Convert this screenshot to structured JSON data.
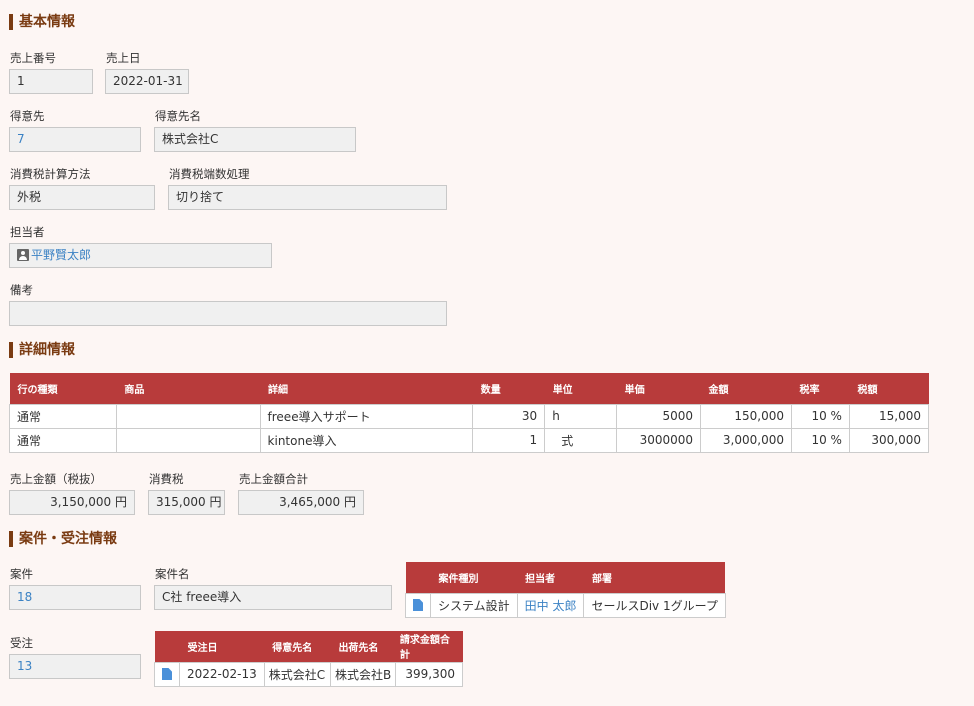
{
  "basic": {
    "title": "基本情報",
    "sales_no": {
      "label": "売上番号",
      "value": "1"
    },
    "sales_date": {
      "label": "売上日",
      "value": "2022-01-31"
    },
    "customer": {
      "label": "得意先",
      "value": "7"
    },
    "customer_name": {
      "label": "得意先名",
      "value": "株式会社C"
    },
    "tax_method": {
      "label": "消費税計算方法",
      "value": "外税"
    },
    "tax_rounding": {
      "label": "消費税端数処理",
      "value": "切り捨て"
    },
    "staff": {
      "label": "担当者",
      "value": "平野賢太郎"
    },
    "remarks": {
      "label": "備考",
      "value": ""
    }
  },
  "detail": {
    "title": "詳細情報",
    "headers": [
      "行の種類",
      "商品",
      "詳細",
      "数量",
      "単位",
      "単価",
      "金額",
      "税率",
      "税額"
    ],
    "rows": [
      [
        "通常",
        "",
        "freee導入サポート",
        "30",
        "h",
        "5000",
        "150,000",
        "10 %",
        "15,000"
      ],
      [
        "通常",
        "",
        "kintone導入",
        "1",
        "式",
        "3000000",
        "3,000,000",
        "10 %",
        "300,000"
      ]
    ],
    "subtotal": {
      "label": "売上金額（税抜）",
      "value": "3,150,000 円"
    },
    "tax": {
      "label": "消費税",
      "value": "315,000 円"
    },
    "total": {
      "label": "売上金額合計",
      "value": "3,465,000 円"
    }
  },
  "project": {
    "title": "案件・受注情報",
    "project_id": {
      "label": "案件",
      "value": "18"
    },
    "project_name": {
      "label": "案件名",
      "value": "C社 freee導入"
    },
    "project_table": {
      "headers": [
        "案件種別",
        "担当者",
        "部署"
      ],
      "rows": [
        [
          "システム設計",
          "田中 太郎",
          "セールスDiv 1グループ"
        ]
      ]
    },
    "order_id": {
      "label": "受注",
      "value": "13"
    },
    "order_table": {
      "headers": [
        "受注日",
        "得意先名",
        "出荷先名",
        "請求金額合計"
      ],
      "rows": [
        [
          "2022-02-13",
          "株式会社C",
          "株式会社B",
          "399,300"
        ]
      ]
    }
  },
  "icons": {
    "staff": "user-icon",
    "record": "document-icon"
  },
  "colors": {
    "accent": "#b83b3b",
    "section": "#7a3b12",
    "link": "#3b82c4",
    "background": "#fdf6f4"
  }
}
